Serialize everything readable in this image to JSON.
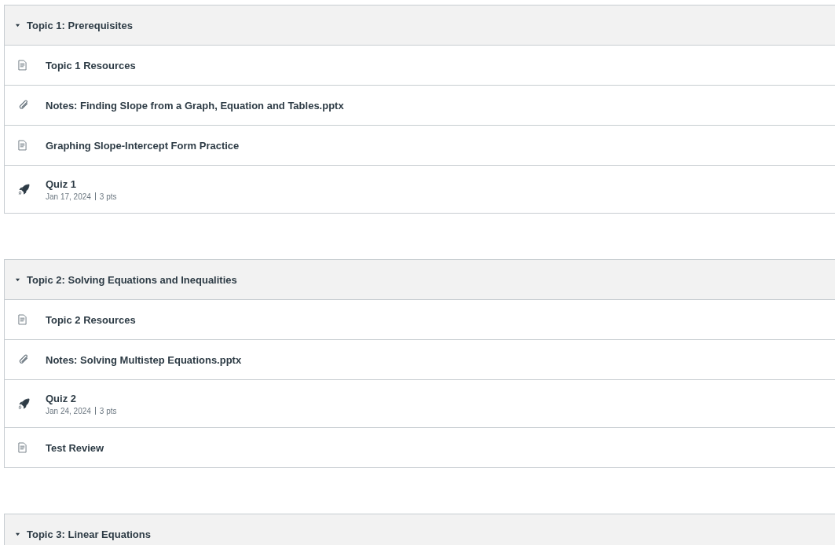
{
  "modules": [
    {
      "title": "Topic 1: Prerequisites",
      "expanded": true,
      "items": [
        {
          "kind": "page",
          "title": "Topic 1 Resources"
        },
        {
          "kind": "attachment",
          "title": "Notes: Finding Slope from a Graph, Equation and Tables.pptx"
        },
        {
          "kind": "page",
          "title": "Graphing Slope-Intercept Form Practice"
        },
        {
          "kind": "quiz",
          "title": "Quiz 1",
          "date": "Jan 17, 2024",
          "points": "3 pts"
        }
      ]
    },
    {
      "title": "Topic 2: Solving Equations and Inequalities",
      "expanded": true,
      "items": [
        {
          "kind": "page",
          "title": "Topic 2 Resources"
        },
        {
          "kind": "attachment",
          "title": "Notes: Solving Multistep Equations.pptx"
        },
        {
          "kind": "quiz",
          "title": "Quiz 2",
          "date": "Jan 24, 2024",
          "points": "3 pts"
        },
        {
          "kind": "page",
          "title": "Test Review"
        }
      ]
    },
    {
      "title": "Topic 3: Linear Equations",
      "expanded": true
    }
  ]
}
